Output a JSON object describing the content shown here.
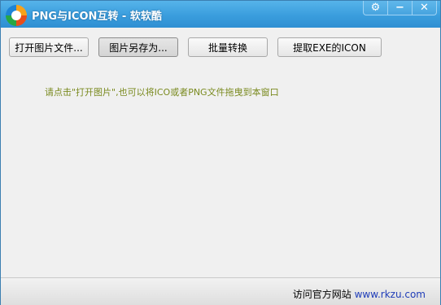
{
  "window": {
    "title": "PNG与ICON互转 - 软软酷"
  },
  "window_controls": {
    "settings_icon": "⚙",
    "minimize_icon": "−",
    "close_icon": "✕"
  },
  "toolbar": {
    "open_label": "打开图片文件...",
    "save_as_label": "图片另存为...",
    "batch_label": "批量转换",
    "extract_label": "提取EXE的ICON"
  },
  "main": {
    "hint": "请点击\"打开图片\",也可以将ICO或者PNG文件拖曳到本窗口"
  },
  "statusbar": {
    "visit_label": "访问官方网站",
    "url": "www.rkzu.com"
  },
  "colors": {
    "titlebar": "#3a9ddd",
    "hint_text": "#7a8a1f",
    "link": "#1e3cb8"
  }
}
